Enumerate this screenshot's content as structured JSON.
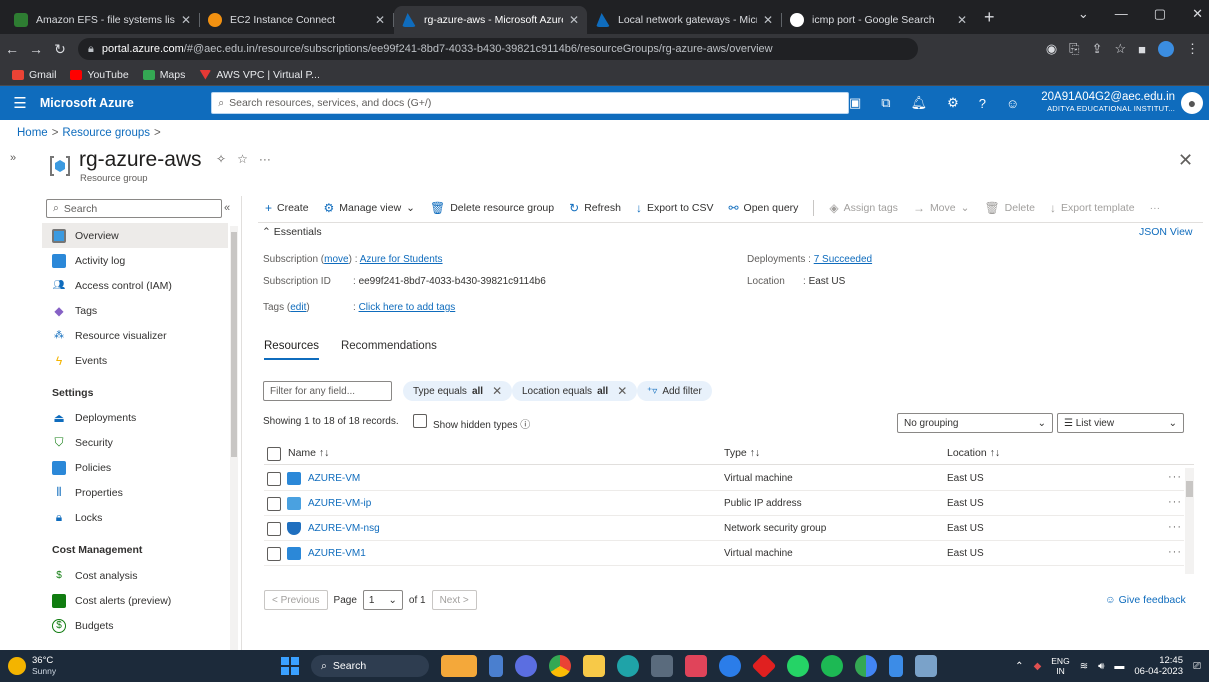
{
  "browser": {
    "tabs": [
      {
        "label": "Amazon EFS - file systems list",
        "color": "#2e7d32"
      },
      {
        "label": "EC2 Instance Connect",
        "color": "#f29111"
      },
      {
        "label": "rg-azure-aws - Microsoft Azure",
        "color": "#0f6cbd"
      },
      {
        "label": "Local network gateways - Micros",
        "color": "#0f6cbd"
      },
      {
        "label": "icmp port - Google Search",
        "color": "#ffffff"
      }
    ],
    "url_host": "portal.azure.com",
    "url_path": "/#@aec.edu.in/resource/subscriptions/ee99f241-8bd7-4033-b430-39821c9114b6/resourceGroups/rg-azure-aws/overview",
    "bookmarks": [
      {
        "label": "Gmail",
        "color": "#ea4335"
      },
      {
        "label": "YouTube",
        "color": "#ff0000"
      },
      {
        "label": "Maps",
        "color": "#34a853"
      },
      {
        "label": "AWS VPC | Virtual P...",
        "color": "#e53935"
      }
    ]
  },
  "azure": {
    "brand": "Microsoft Azure",
    "search_placeholder": "Search resources, services, and docs (G+/)",
    "account_email": "20A91A04G2@aec.edu.in",
    "account_org": "ADITYA EDUCATIONAL INSTITUT..."
  },
  "breadcrumb": {
    "home": "Home",
    "groups": "Resource groups"
  },
  "resource": {
    "name": "rg-azure-aws",
    "type": "Resource group"
  },
  "nav": {
    "search_placeholder": "Search",
    "items": [
      {
        "label": "Overview",
        "color": "#0f6cbd"
      },
      {
        "label": "Activity log",
        "color": "#2b88d8"
      },
      {
        "label": "Access control (IAM)",
        "color": "#0f6cbd"
      },
      {
        "label": "Tags",
        "color": "#8661c5"
      },
      {
        "label": "Resource visualizer",
        "color": "#0f6cbd"
      },
      {
        "label": "Events",
        "color": "#f4b400"
      }
    ],
    "settings_header": "Settings",
    "settings": [
      {
        "label": "Deployments",
        "color": "#0f6cbd"
      },
      {
        "label": "Security",
        "color": "#107c10"
      },
      {
        "label": "Policies",
        "color": "#2b88d8"
      },
      {
        "label": "Properties",
        "color": "#0f6cbd"
      },
      {
        "label": "Locks",
        "color": "#0f6cbd"
      }
    ],
    "cost_header": "Cost Management",
    "cost": [
      {
        "label": "Cost analysis",
        "color": "#107c10"
      },
      {
        "label": "Cost alerts (preview)",
        "color": "#107c10"
      },
      {
        "label": "Budgets",
        "color": "#107c10"
      }
    ]
  },
  "toolbar": {
    "create": "Create",
    "manage_view": "Manage view",
    "delete_rg": "Delete resource group",
    "refresh": "Refresh",
    "export_csv": "Export to CSV",
    "open_query": "Open query",
    "assign_tags": "Assign tags",
    "move": "Move",
    "delete": "Delete",
    "export_template": "Export template"
  },
  "essentials": {
    "title": "Essentials",
    "json_view": "JSON View",
    "subscription_label": "Subscription",
    "move_link": "move",
    "subscription_value": "Azure for Students",
    "subid_label": "Subscription ID",
    "subid_value": "ee99f241-8bd7-4033-b430-39821c9114b6",
    "tags_label": "Tags",
    "edit_link": "edit",
    "tags_value": "Click here to add tags",
    "deployments_label": "Deployments",
    "deployments_value": "7 Succeeded",
    "location_label": "Location",
    "location_value": "East US"
  },
  "restabs": {
    "resources": "Resources",
    "recommendations": "Recommendations"
  },
  "filters": {
    "placeholder": "Filter for any field...",
    "type_prefix": "Type equals",
    "type_value": "all",
    "loc_prefix": "Location equals",
    "loc_value": "all",
    "add": "Add filter"
  },
  "list": {
    "showing": "Showing 1 to 18 of 18 records.",
    "show_hidden": "Show hidden types",
    "grouping": "No grouping",
    "view": "List view",
    "col_name": "Name ↑↓",
    "col_type": "Type ↑↓",
    "col_location": "Location ↑↓",
    "rows": [
      {
        "name": "AZURE-VM",
        "type": "Virtual machine",
        "location": "East US",
        "color": "#2b88d8"
      },
      {
        "name": "AZURE-VM-ip",
        "type": "Public IP address",
        "location": "East US",
        "color": "#4aa1e0"
      },
      {
        "name": "AZURE-VM-nsg",
        "type": "Network security group",
        "location": "East US",
        "color": "#1f6fbf"
      },
      {
        "name": "AZURE-VM1",
        "type": "Virtual machine",
        "location": "East US",
        "color": "#2b88d8"
      }
    ]
  },
  "pager": {
    "prev": "< Previous",
    "page": "Page",
    "current": "1",
    "of": "of 1",
    "next": "Next >"
  },
  "feedback": "Give feedback",
  "taskbar": {
    "temp": "36°C",
    "weather": "Sunny",
    "search": "Search",
    "lang1": "ENG",
    "lang2": "IN",
    "time": "12:45",
    "date": "06-04-2023"
  }
}
